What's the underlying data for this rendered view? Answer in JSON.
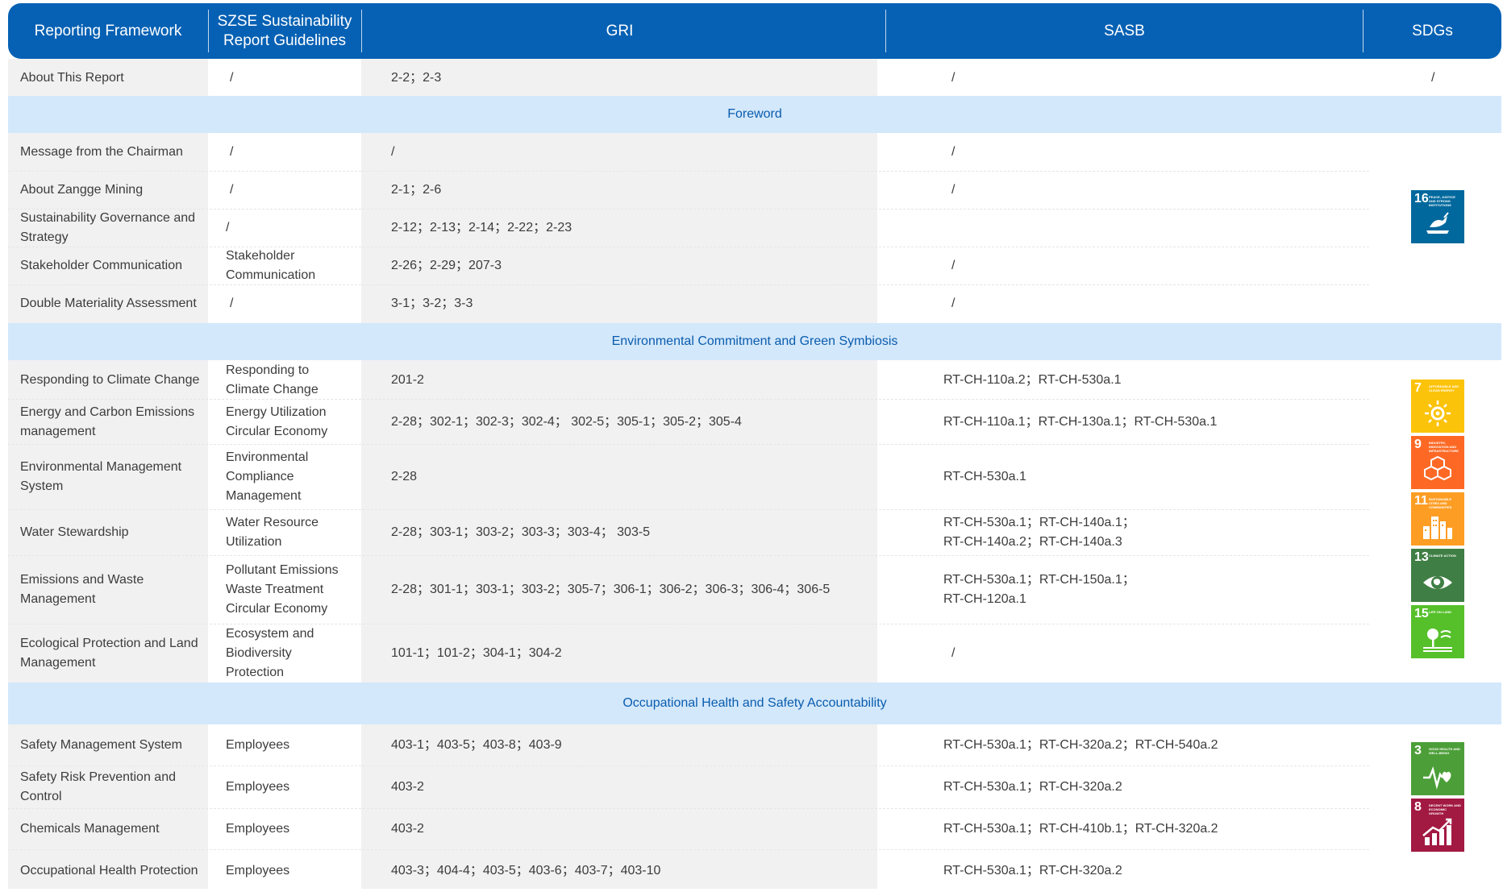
{
  "header": {
    "framework": "Reporting Framework",
    "szse": "SZSE Sustainability Report Guidelines",
    "gri": "GRI",
    "sasb": "SASB",
    "sdgs": "SDGs"
  },
  "about_row": {
    "framework": "About This Report",
    "szse": "/",
    "gri": "2-2；2-3",
    "sasb": "/",
    "sdg": "/"
  },
  "sections": {
    "foreword": "Foreword",
    "environment": "Environmental Commitment and Green Symbiosis",
    "ohs": "Occupational Health and Safety Accountability"
  },
  "foreword_rows": [
    {
      "framework": "Message from the Chairman",
      "szse": "/",
      "gri": "/",
      "sasb": "/"
    },
    {
      "framework": "About Zangge Mining",
      "szse": "/",
      "gri": "2-1；2-6",
      "sasb": "/"
    },
    {
      "framework": "Sustainability Governance and Strategy",
      "szse": "/",
      "gri": "2-12；2-13；2-14；2-22；2-23",
      "sasb": ""
    },
    {
      "framework": "Stakeholder Communication",
      "szse": "Stakeholder Communication",
      "gri": "2-26；2-29；207-3",
      "sasb": "/"
    },
    {
      "framework": "Double Materiality Assessment",
      "szse": "/",
      "gri": "3-1；3-2；3-3",
      "sasb": "/"
    }
  ],
  "environment_rows": [
    {
      "framework": "Responding to Climate Change",
      "szse": "Responding to Climate Change",
      "gri": "201-2",
      "sasb": "RT-CH-110a.2；RT-CH-530a.1"
    },
    {
      "framework": "Energy and Carbon Emissions management",
      "szse": "Energy Utilization Circular Economy",
      "gri": "2-28；302-1；302-3；302-4； 302-5；305-1；305-2；305-4",
      "sasb": "RT-CH-110a.1；RT-CH-130a.1；RT-CH-530a.1"
    },
    {
      "framework": "Environmental Management System",
      "szse": "Environmental Compliance Management",
      "gri": "2-28",
      "sasb": "RT-CH-530a.1"
    },
    {
      "framework": "Water Stewardship",
      "szse": "Water Resource Utilization",
      "gri": "2-28；303-1；303-2；303-3；303-4； 303-5",
      "sasb": "RT-CH-530a.1；RT-CH-140a.1；RT-CH-140a.2；RT-CH-140a.3"
    },
    {
      "framework": "Emissions and Waste Management",
      "szse": "Pollutant Emissions Waste Treatment Circular Economy",
      "gri": "2-28；301-1；303-1；303-2；305-7；306-1；306-2；306-3；306-4；306-5",
      "sasb": "RT-CH-530a.1；RT-CH-150a.1；RT-CH-120a.1"
    },
    {
      "framework": "Ecological Protection and Land Management",
      "szse": "Ecosystem and Biodiversity Protection",
      "gri": "101-1；101-2；304-1；304-2",
      "sasb": "/"
    }
  ],
  "ohs_rows": [
    {
      "framework": "Safety Management System",
      "szse": "Employees",
      "gri": "403-1；403-5；403-8；403-9",
      "sasb": "RT-CH-530a.1；RT-CH-320a.2；RT-CH-540a.2"
    },
    {
      "framework": "Safety Risk Prevention and Control",
      "szse": "Employees",
      "gri": "403-2",
      "sasb": "RT-CH-530a.1；RT-CH-320a.2"
    },
    {
      "framework": "Chemicals Management",
      "szse": "Employees",
      "gri": "403-2",
      "sasb": "RT-CH-530a.1；RT-CH-410b.1；RT-CH-320a.2"
    },
    {
      "framework": "Occupational Health Protection",
      "szse": "Employees",
      "gri": "403-3；404-4；403-5；403-6；403-7；403-10",
      "sasb": "RT-CH-530a.1；RT-CH-320a.2"
    }
  ],
  "sdg_icons": {
    "sdg16": {
      "num": "16",
      "text": "PEACE, JUSTICE AND STRONG INSTITUTIONS",
      "color": "#00689d",
      "icon": "dove-icon"
    },
    "sdg7": {
      "num": "7",
      "text": "AFFORDABLE AND CLEAN ENERGY",
      "color": "#fcc30b",
      "icon": "sun-icon"
    },
    "sdg9": {
      "num": "9",
      "text": "INDUSTRY, INNOVATION AND INFRASTRUCTURE",
      "color": "#fd6925",
      "icon": "cubes-icon"
    },
    "sdg11": {
      "num": "11",
      "text": "SUSTAINABLE CITIES AND COMMUNITIES",
      "color": "#fd9d24",
      "icon": "city-icon"
    },
    "sdg13": {
      "num": "13",
      "text": "CLIMATE ACTION",
      "color": "#3f7e44",
      "icon": "eye-globe-icon"
    },
    "sdg15": {
      "num": "15",
      "text": "LIFE ON LAND",
      "color": "#56c02b",
      "icon": "tree-icon"
    },
    "sdg3": {
      "num": "3",
      "text": "GOOD HEALTH AND WELL-BEING",
      "color": "#4c9f38",
      "icon": "heartbeat-icon"
    },
    "sdg8": {
      "num": "8",
      "text": "DECENT WORK AND ECONOMIC GROWTH",
      "color": "#a21942",
      "icon": "growth-chart-icon"
    }
  }
}
